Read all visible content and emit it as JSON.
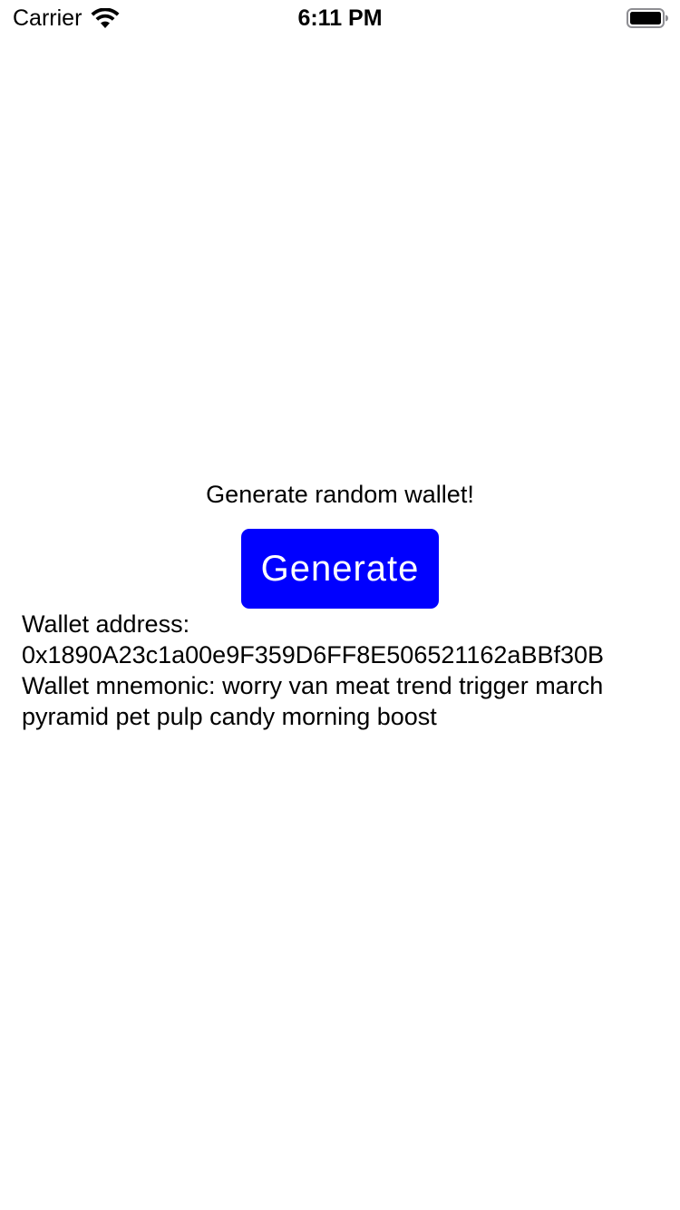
{
  "status_bar": {
    "carrier": "Carrier",
    "time": "6:11 PM",
    "wifi_icon": "wifi-icon",
    "battery_icon": "battery-full-icon"
  },
  "main": {
    "prompt": "Generate random wallet!",
    "generate_button_label": "Generate",
    "button_color": "#0000ff",
    "address_label": "Wallet address:",
    "address_value": "0x1890A23c1a00e9F359D6FF8E506521162aBBf30B",
    "mnemonic_line1": "Wallet mnemonic: worry van meat trend trigger march",
    "mnemonic_line2": "pyramid pet pulp candy morning boost"
  }
}
